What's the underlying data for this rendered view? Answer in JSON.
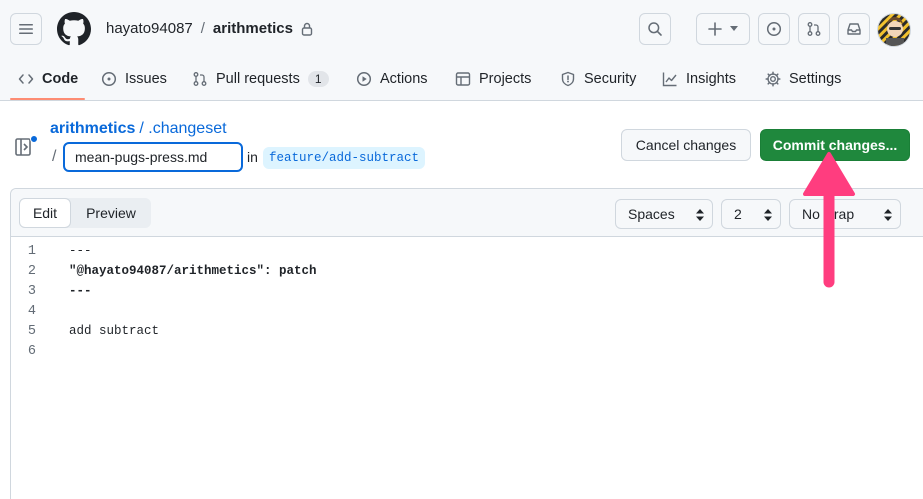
{
  "header": {
    "owner": "hayato94087",
    "separator": "/",
    "repo": "arithmetics"
  },
  "nav": {
    "code": "Code",
    "issues": "Issues",
    "pull_requests": "Pull requests",
    "pull_requests_count": "1",
    "actions": "Actions",
    "projects": "Projects",
    "security": "Security",
    "insights": "Insights",
    "settings": "Settings"
  },
  "path": {
    "repo_link": "arithmetics",
    "folder": "/ .changeset",
    "slash": "/",
    "filename": "mean-pugs-press.md",
    "in_label": "in",
    "branch": "feature/add-subtract"
  },
  "actions": {
    "cancel": "Cancel changes",
    "commit": "Commit changes..."
  },
  "editor": {
    "edit_tab": "Edit",
    "preview_tab": "Preview",
    "indent_mode": "Spaces",
    "indent_size": "2",
    "wrap_mode": "No wrap",
    "lines": [
      {
        "n": "1",
        "text": "---"
      },
      {
        "n": "2",
        "text": "\"@hayato94087/arithmetics\": patch"
      },
      {
        "n": "3",
        "text": "---"
      },
      {
        "n": "4",
        "text": ""
      },
      {
        "n": "5",
        "text": "add subtract"
      },
      {
        "n": "6",
        "text": ""
      }
    ]
  },
  "colors": {
    "accent": "#0969da",
    "commit_green": "#1f883d",
    "annotation_arrow": "#ff3d7f",
    "tab_underline": "#fd8c73"
  }
}
